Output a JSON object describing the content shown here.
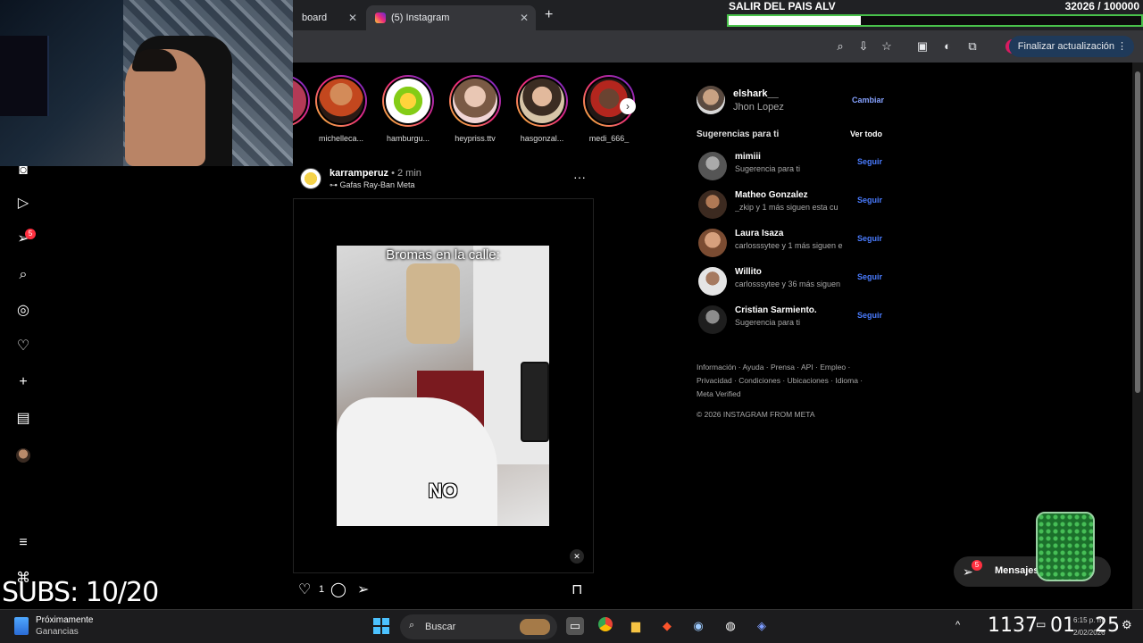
{
  "goal": {
    "title": "SALIR DEL PAIS ALV",
    "count": "32026 / 100000",
    "fraction": 0.32
  },
  "browser": {
    "tabs": [
      {
        "label": "board"
      },
      {
        "label": "(5) Instagram"
      }
    ],
    "update_label": "Finalizar actualización",
    "profile_initial": "J"
  },
  "nav": {
    "notifications_badge": "5"
  },
  "stories": [
    {
      "name": "michelleca..."
    },
    {
      "name": "hamburgu..."
    },
    {
      "name": "heypriss.ttv"
    },
    {
      "name": "hasgonzal..."
    },
    {
      "name": "medi_666_"
    }
  ],
  "post": {
    "username": "karramperuz",
    "time": " • 2 min",
    "subtitle": "Gafas Ray-Ban Meta",
    "video_title": "Bromas en la calle:",
    "video_caption": "NO",
    "likes": "1"
  },
  "account": {
    "username": "elshark__",
    "name": "Jhon Lopez",
    "switch_label": "Cambiar"
  },
  "suggestions": {
    "title": "Sugerencias para ti",
    "see_all": "Ver todo",
    "follow_label": "Seguir",
    "items": [
      {
        "username": "mimiii",
        "sub": "Sugerencia para ti"
      },
      {
        "username": "Matheo Gonzalez",
        "sub": "_zkip y 1 más siguen esta cu"
      },
      {
        "username": "Laura Isaza",
        "sub": "carlosssytee y 1 más siguen e"
      },
      {
        "username": "Willito",
        "sub": "carlosssytee y 36 más siguen"
      },
      {
        "username": "Cristian Sarmiento.",
        "sub": "Sugerencia para ti"
      }
    ]
  },
  "footer": {
    "line1": "Información · Ayuda · Prensa · API · Empleo ·",
    "line2": "Privacidad · Condiciones · Ubicaciones · Idioma ·",
    "line3": "Meta Verified",
    "copyright": "© 2026 INSTAGRAM FROM META"
  },
  "messages": {
    "label": "Mensajes",
    "badge": "5"
  },
  "overlay": {
    "subs": "SUBS: 10/20"
  },
  "taskbar": {
    "widget_title": "Próximamente",
    "widget_sub": "Ganancias",
    "search": "Buscar",
    "clock_hours": "1137",
    "clock_minutes": "01",
    "clock_seconds": "25",
    "time": "6:15 p. m.",
    "date": "2/02/2026"
  }
}
